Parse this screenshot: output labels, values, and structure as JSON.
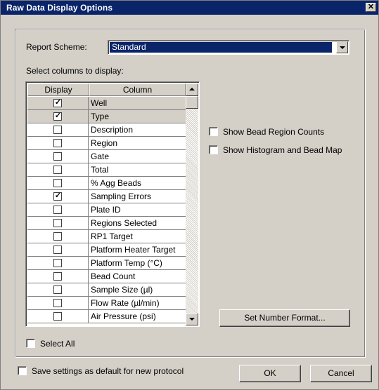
{
  "window": {
    "title": "Raw Data Display Options",
    "close_glyph": "✕"
  },
  "report_scheme": {
    "label": "Report Scheme:",
    "value": "Standard"
  },
  "columns": {
    "label": "Select columns to display:",
    "headers": [
      "Display",
      "Column"
    ],
    "rows": [
      {
        "name": "Well",
        "checked": true,
        "shaded": true
      },
      {
        "name": "Type",
        "checked": true,
        "shaded": true
      },
      {
        "name": "Description",
        "checked": false,
        "shaded": false
      },
      {
        "name": "Region",
        "checked": false,
        "shaded": false
      },
      {
        "name": "Gate",
        "checked": false,
        "shaded": false
      },
      {
        "name": "Total",
        "checked": false,
        "shaded": false
      },
      {
        "name": "% Agg Beads",
        "checked": false,
        "shaded": false
      },
      {
        "name": "Sampling Errors",
        "checked": true,
        "shaded": false
      },
      {
        "name": "Plate ID",
        "checked": false,
        "shaded": false
      },
      {
        "name": "Regions Selected",
        "checked": false,
        "shaded": false
      },
      {
        "name": "RP1 Target",
        "checked": false,
        "shaded": false
      },
      {
        "name": "Platform Heater Target",
        "checked": false,
        "shaded": false
      },
      {
        "name": "Platform Temp (°C)",
        "checked": false,
        "shaded": false
      },
      {
        "name": "Bead Count",
        "checked": false,
        "shaded": false
      },
      {
        "name": "Sample Size (µl)",
        "checked": false,
        "shaded": false
      },
      {
        "name": "Flow Rate (µl/min)",
        "checked": false,
        "shaded": false
      },
      {
        "name": "Air Pressure (psi)",
        "checked": false,
        "shaded": false
      }
    ]
  },
  "options": {
    "show_bead_region_counts": "Show Bead Region Counts",
    "show_histogram": "Show Histogram and Bead Map"
  },
  "select_all": "Select All",
  "save_default": "Save settings as default for new protocol",
  "buttons": {
    "set_number_format": "Set Number Format...",
    "ok": "OK",
    "cancel": "Cancel"
  },
  "check_glyph": "✓"
}
